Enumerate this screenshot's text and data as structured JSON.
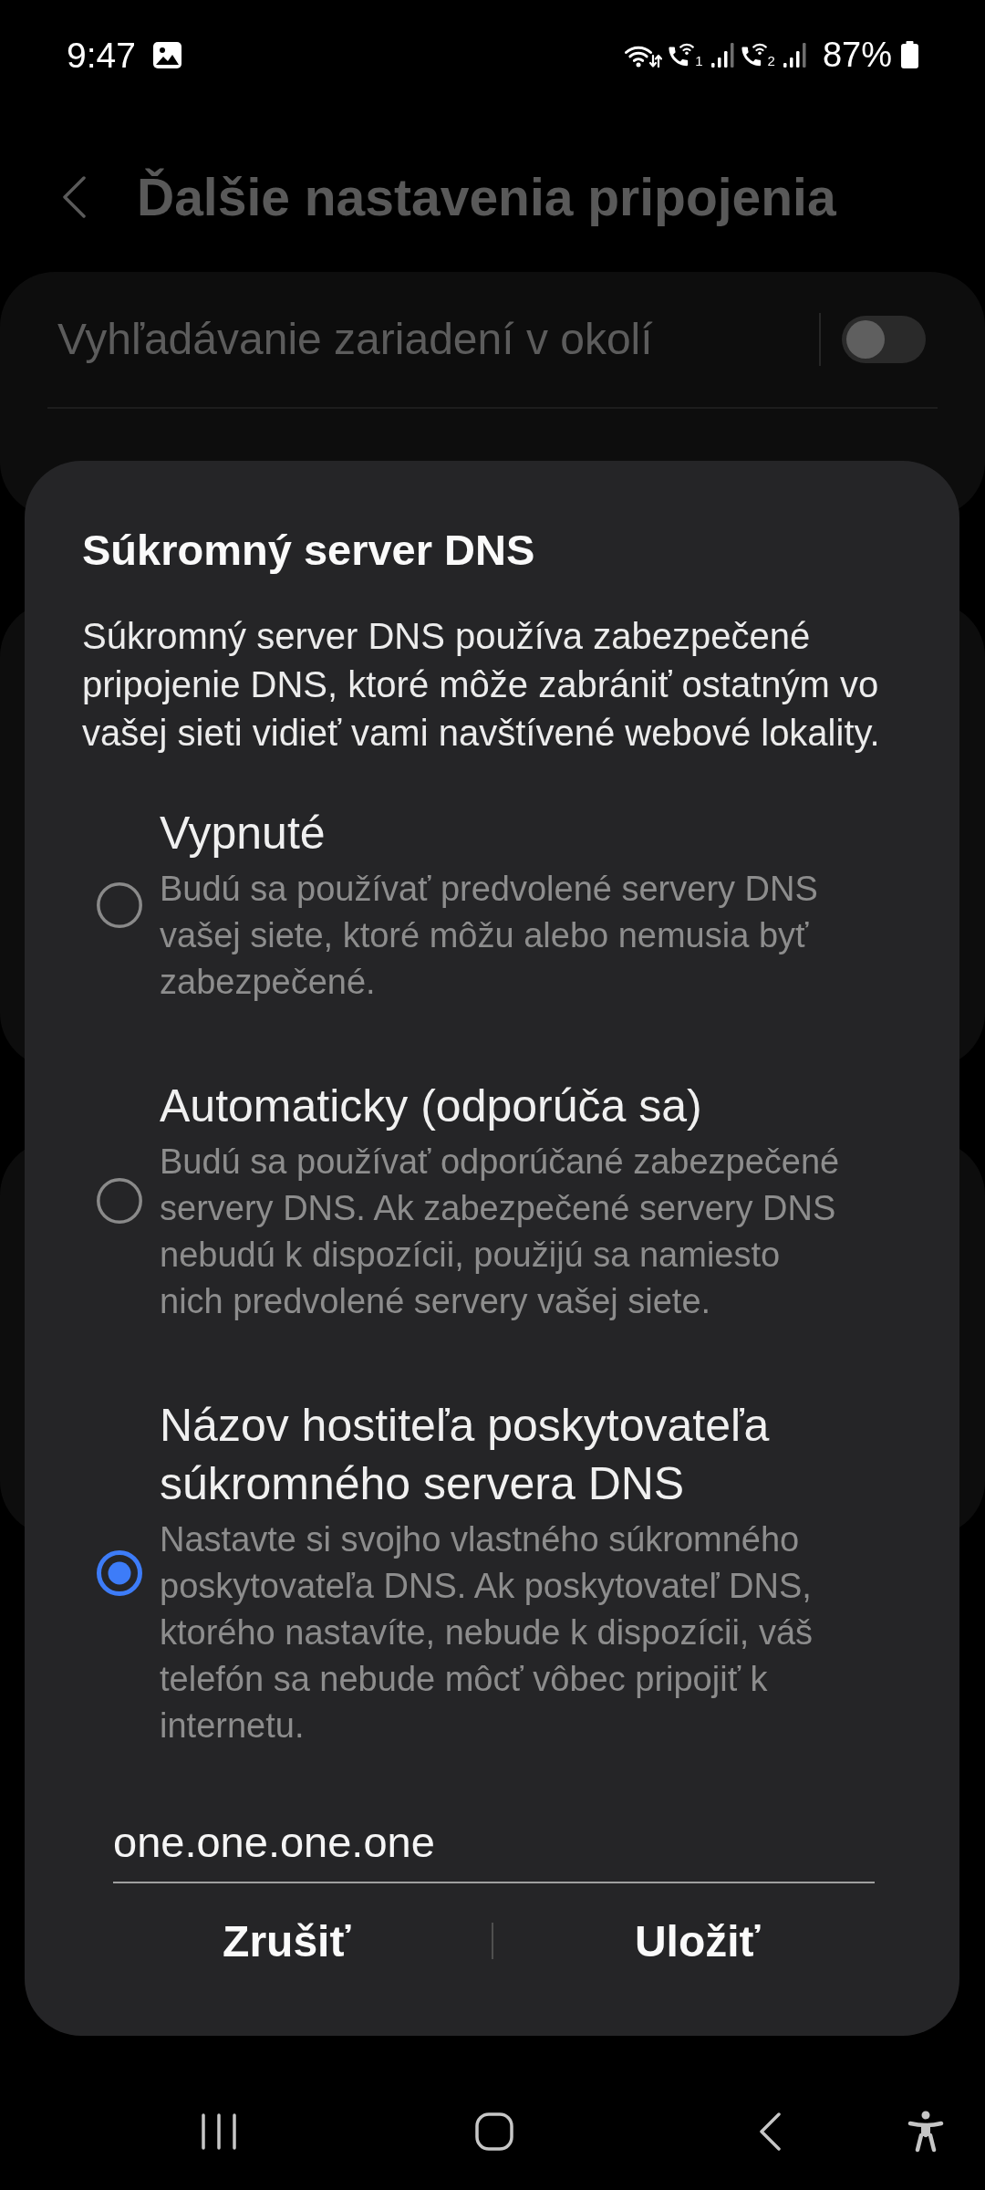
{
  "status_bar": {
    "time": "9:47",
    "sims": [
      {
        "label": "1"
      },
      {
        "label": "2"
      }
    ],
    "battery": "87%"
  },
  "header": {
    "title": "Ďalšie nastavenia pripojenia"
  },
  "settings": [
    {
      "label": "Vyhľadávanie zariadení v okolí",
      "on": false
    }
  ],
  "dialog": {
    "title": "Súkromný server DNS",
    "description": "Súkromný server DNS používa zabezpečené pripojenie DNS, ktoré môže zabrániť ostatným vo vašej sieti vidieť vami navštívené webové lokality.",
    "options": [
      {
        "title": "Vypnuté",
        "description": "Budú sa používať predvolené servery DNS vašej siete, ktoré môžu alebo nemusia byť zabezpečené.",
        "selected": false
      },
      {
        "title": "Automaticky (odporúča sa)",
        "description": "Budú sa používať odporúčané zabezpečené servery DNS. Ak zabezpečené servery DNS nebudú k dispozícii, použijú sa namiesto nich predvolené servery vašej siete.",
        "selected": false
      },
      {
        "title": "Názov hostiteľa poskytovateľa súkromného servera DNS",
        "description": "Nastavte si svojho vlastného súkromného poskytovateľa DNS. Ak poskytovateľ DNS, ktorého nastavíte, nebude k dispozícii, váš telefón sa nebude môcť vôbec pripojiť k internetu.",
        "selected": true
      }
    ],
    "hostname": {
      "value": "one.one.one.one"
    },
    "buttons": [
      "Zrušiť",
      "Uložiť"
    ]
  }
}
